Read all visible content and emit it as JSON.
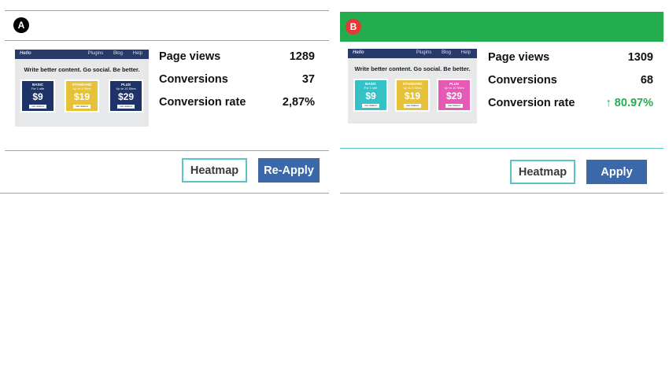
{
  "variant_a": {
    "badge": "A",
    "thumbnail": {
      "logo": "Hello",
      "nav_links": [
        "Plugins",
        "Blog",
        "Help"
      ],
      "headline": "Write better content. Go social. Be better.",
      "plans": [
        {
          "name": "BASIC",
          "sub": "For 1 site",
          "price": "$9",
          "cta": "Get Started",
          "bg": "#1e3368"
        },
        {
          "name": "STANDARD",
          "sub": "Up to 5 Sites",
          "price": "$19",
          "cta": "Get Started",
          "bg": "#e6c13a"
        },
        {
          "name": "PLUS",
          "sub": "Up to 10 Sites",
          "price": "$29",
          "cta": "Get Started",
          "bg": "#1e3368"
        }
      ]
    },
    "stats": [
      {
        "label": "Page views",
        "value": "1289"
      },
      {
        "label": "Conversions",
        "value": "37"
      },
      {
        "label": "Conversion rate",
        "value": "2,87%"
      }
    ],
    "buttons": {
      "heatmap": "Heatmap",
      "apply": "Re-Apply"
    }
  },
  "variant_b": {
    "badge": "B",
    "header_color": "#24ad4e",
    "thumbnail": {
      "logo": "Hello",
      "nav_links": [
        "Plugins",
        "Blog",
        "Help"
      ],
      "headline": "Write better content. Go social. Be better.",
      "plans": [
        {
          "name": "BASIC",
          "sub": "For 1 site",
          "price": "$9",
          "cta": "Get Started",
          "bg": "#35c2c6"
        },
        {
          "name": "STANDARD",
          "sub": "Up to 5 Sites",
          "price": "$19",
          "cta": "Get Started",
          "bg": "#e6c13a"
        },
        {
          "name": "PLUS",
          "sub": "Up to 10 Sites",
          "price": "$29",
          "cta": "Get Started",
          "bg": "#e45ab4"
        }
      ]
    },
    "stats": [
      {
        "label": "Page views",
        "value": "1309"
      },
      {
        "label": "Conversions",
        "value": "68"
      },
      {
        "label": "Conversion rate",
        "value": "↑ 80.97%"
      }
    ],
    "buttons": {
      "heatmap": "Heatmap",
      "apply": "Apply"
    }
  },
  "colors": {
    "accent_teal": "#5bc4c9",
    "primary_blue": "#3b68a8",
    "success_green": "#24ad4e"
  }
}
